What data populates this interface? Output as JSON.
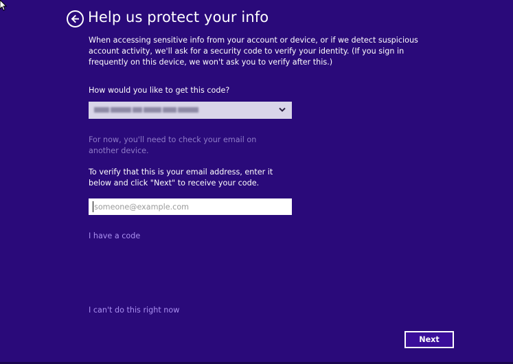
{
  "page": {
    "title": "Help us protect your info",
    "intro": "When accessing sensitive info from your account or device, or if we detect suspicious account activity, we'll ask for a security code to verify your identity. (If you sign in frequently on this device, we won't ask you to verify after this.)"
  },
  "method": {
    "label": "How would you like to get this code?",
    "selected_value_redacted": true
  },
  "note": "For now, you'll need to check your email on another device.",
  "verify": {
    "text": "To verify that this is your email address, enter it below and click \"Next\" to receive your code.",
    "email_placeholder": "someone@example.com",
    "email_value": ""
  },
  "links": {
    "have_code": "I have a code",
    "cant_now": "I can't do this right now"
  },
  "buttons": {
    "next": "Next"
  },
  "icons": {
    "back": "back-arrow-icon",
    "chevron": "chevron-down-icon",
    "cursor": "mouse-pointer-icon"
  },
  "colors": {
    "background": "#2a0a7a",
    "link": "#a98ff0",
    "note": "#8f7cc8",
    "select_bg": "#d9d5e9"
  }
}
